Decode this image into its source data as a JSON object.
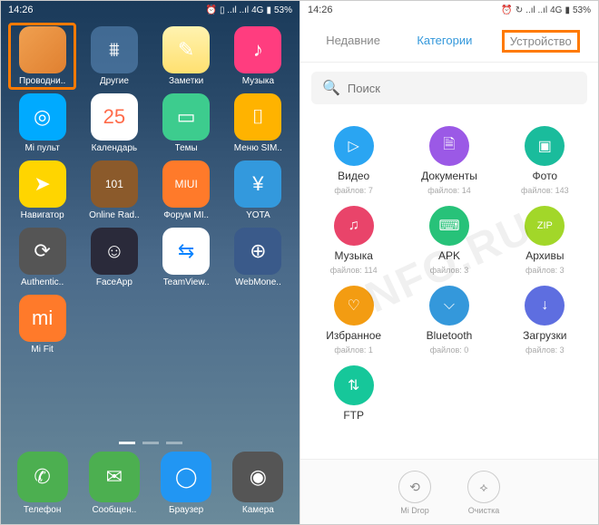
{
  "status": {
    "time": "14:26",
    "net": "4G",
    "battery": "53%"
  },
  "homescreen": {
    "apps": [
      {
        "label": "Проводни..",
        "bg": "bg-folder",
        "glyph": " ",
        "highlight": true
      },
      {
        "label": "Другие",
        "bg": "bg-blue-folder",
        "glyph": "⩩"
      },
      {
        "label": "Заметки",
        "bg": "bg-notes",
        "glyph": "✎"
      },
      {
        "label": "Музыка",
        "bg": "bg-music",
        "glyph": "♪"
      },
      {
        "label": "Mi пульт",
        "bg": "bg-remote",
        "glyph": "◎"
      },
      {
        "label": "Календарь",
        "bg": "bg-cal",
        "glyph": "25"
      },
      {
        "label": "Темы",
        "bg": "bg-themes",
        "glyph": "▭"
      },
      {
        "label": "Меню SIM..",
        "bg": "bg-sim",
        "glyph": "⌷"
      },
      {
        "label": "Навигатор",
        "bg": "bg-nav",
        "glyph": "➤"
      },
      {
        "label": "Online Rad..",
        "bg": "bg-radio",
        "glyph": "101"
      },
      {
        "label": "Форум MI..",
        "bg": "bg-miui",
        "glyph": "MIUI"
      },
      {
        "label": "YOTA",
        "bg": "bg-yota",
        "glyph": "¥"
      },
      {
        "label": "Authentic..",
        "bg": "bg-auth",
        "glyph": "⟳"
      },
      {
        "label": "FaceApp",
        "bg": "bg-face",
        "glyph": "☺"
      },
      {
        "label": "TeamView..",
        "bg": "bg-team",
        "glyph": "⇆"
      },
      {
        "label": "WebMone..",
        "bg": "bg-web",
        "glyph": "⊕"
      },
      {
        "label": "Mi Fit",
        "bg": "bg-mifit",
        "glyph": "mi"
      }
    ],
    "dock": [
      {
        "label": "Телефон",
        "bg": "bg-phone",
        "glyph": "✆"
      },
      {
        "label": "Сообщен..",
        "bg": "bg-msg",
        "glyph": "✉"
      },
      {
        "label": "Браузер",
        "bg": "bg-browser",
        "glyph": "◯"
      },
      {
        "label": "Камера",
        "bg": "bg-camera",
        "glyph": "◉"
      }
    ]
  },
  "explorer": {
    "tabs": [
      {
        "label": "Недавние"
      },
      {
        "label": "Категории",
        "active": true
      },
      {
        "label": "Устройство",
        "highlight": true
      }
    ],
    "search_placeholder": "Поиск",
    "categories": [
      {
        "name": "Видео",
        "count": "файлов: 7",
        "cls": "c-blue",
        "glyph": "▷"
      },
      {
        "name": "Документы",
        "count": "файлов: 14",
        "cls": "c-purple",
        "glyph": "🗎"
      },
      {
        "name": "Фото",
        "count": "файлов: 143",
        "cls": "c-teal",
        "glyph": "▣"
      },
      {
        "name": "Музыка",
        "count": "файлов: 114",
        "cls": "c-pink",
        "glyph": "♫"
      },
      {
        "name": "APK",
        "count": "файлов: 3",
        "cls": "c-green",
        "glyph": "⌨"
      },
      {
        "name": "Архивы",
        "count": "файлов: 3",
        "cls": "c-lime",
        "glyph": "ZIP"
      },
      {
        "name": "Избранное",
        "count": "файлов: 1",
        "cls": "c-orange",
        "glyph": "♡"
      },
      {
        "name": "Bluetooth",
        "count": "файлов: 0",
        "cls": "c-blue2",
        "glyph": "⌵"
      },
      {
        "name": "Загрузки",
        "count": "файлов: 3",
        "cls": "c-indigo",
        "glyph": "↓"
      },
      {
        "name": "FTP",
        "count": "",
        "cls": "c-cyan",
        "glyph": "⇅"
      }
    ],
    "actions": [
      {
        "label": "Mi Drop",
        "glyph": "⟲"
      },
      {
        "label": "Очистка",
        "glyph": "⟡"
      }
    ]
  },
  "watermark": "NFO.RU"
}
